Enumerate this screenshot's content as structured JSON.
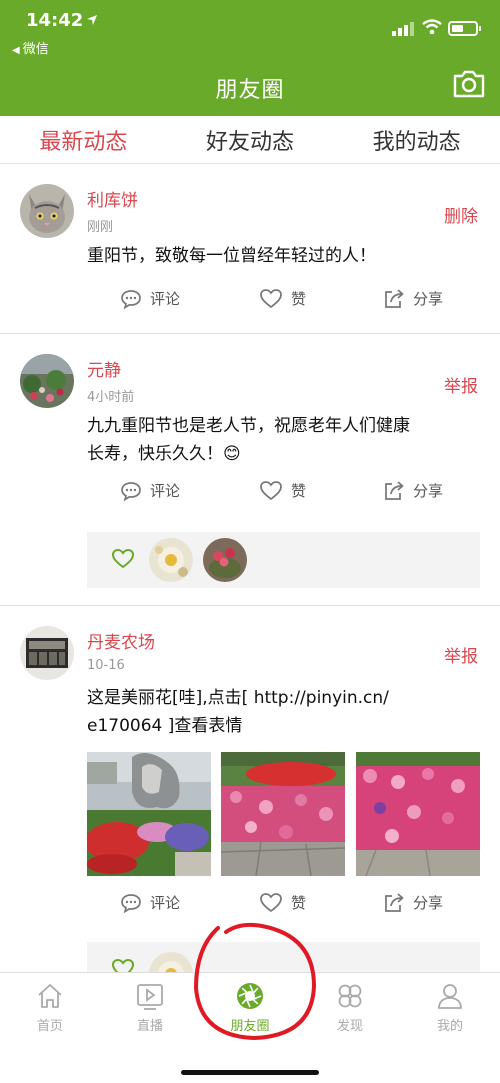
{
  "status_bar": {
    "time": "14:42",
    "back_app": "微信"
  },
  "header": {
    "title": "朋友圈",
    "camera_icon": "camera-icon"
  },
  "tabs": [
    {
      "label": "最新动态",
      "active": true
    },
    {
      "label": "好友动态",
      "active": false
    },
    {
      "label": "我的动态",
      "active": false
    }
  ],
  "actions": {
    "comment": "评论",
    "like": "赞",
    "share": "分享"
  },
  "posts": [
    {
      "user": "利库饼",
      "time": "刚刚",
      "action": "删除",
      "text_lines": [
        "重阳节，致敬每一位曾经年轻过的人！"
      ]
    },
    {
      "user": "元静",
      "time": "4小时前",
      "action": "举报",
      "text_lines": [
        "九九重阳节也是老人节，祝愿老年人们健康",
        "长寿，快乐久久！😊"
      ]
    },
    {
      "user": "丹麦农场",
      "time": "10-16",
      "action": "举报",
      "text_lines": [
        "这是美丽花[哇],点击[ http://pinyin.cn/",
        "e170064 ]查看表情"
      ]
    }
  ],
  "tabbar": [
    {
      "label": "首页",
      "icon": "home-icon"
    },
    {
      "label": "直播",
      "icon": "live-icon"
    },
    {
      "label": "朋友圈",
      "icon": "moments-icon",
      "active": true
    },
    {
      "label": "发现",
      "icon": "discover-icon"
    },
    {
      "label": "我的",
      "icon": "profile-icon"
    }
  ],
  "colors": {
    "brand_green": "#6aaa2a",
    "accent_red": "#d9474f",
    "annotation_circle": "#e01a24"
  }
}
